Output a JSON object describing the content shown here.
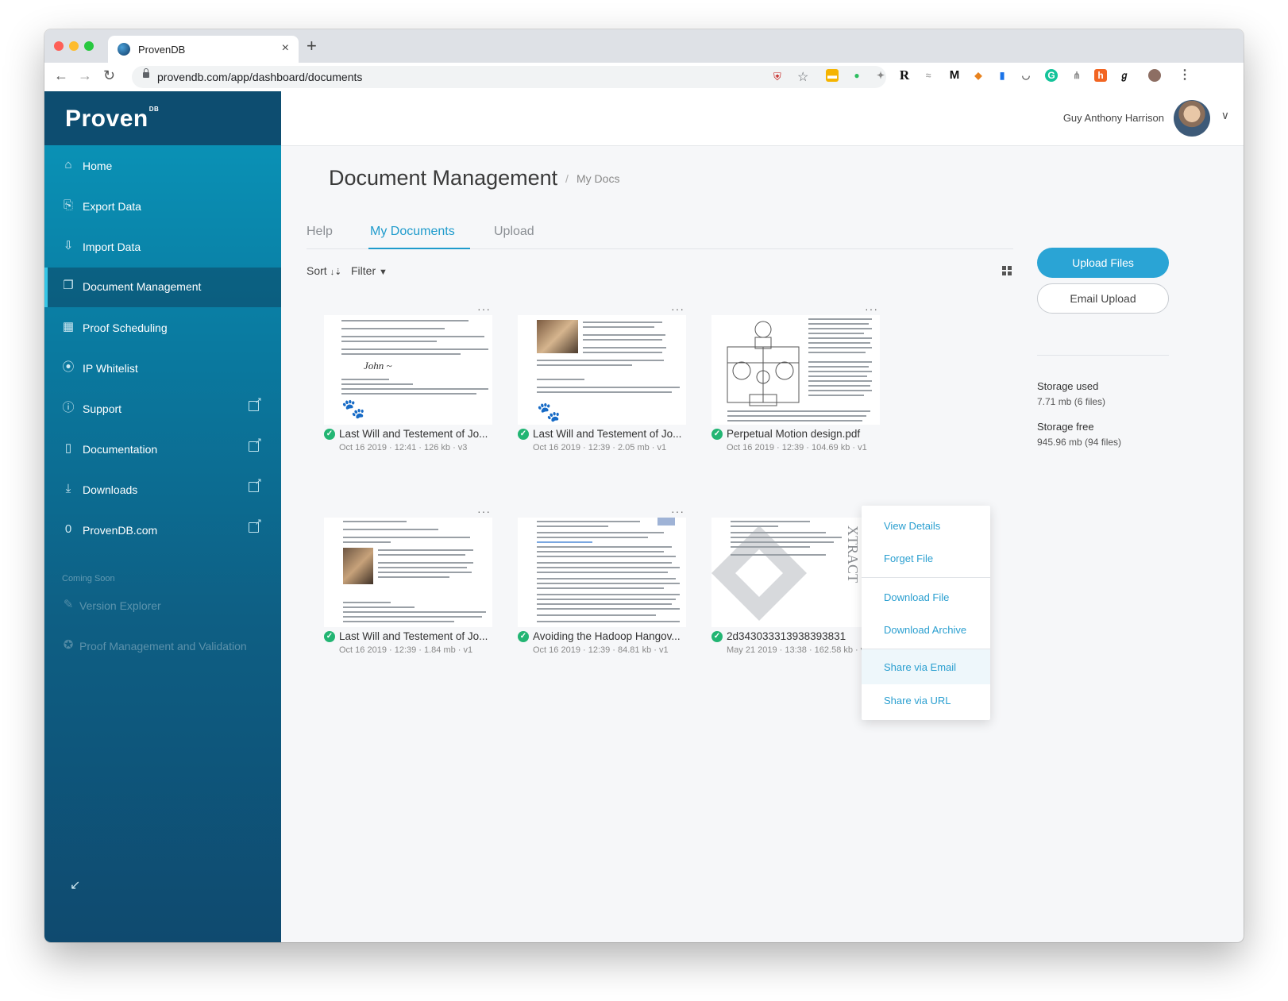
{
  "browser": {
    "tab_title": "ProvenDB",
    "url": "provendb.com/app/dashboard/documents"
  },
  "sidebar": {
    "logo": "Proven",
    "logo_sup": "DB",
    "items": [
      {
        "label": "Home",
        "icon": "home-icon"
      },
      {
        "label": "Export Data",
        "icon": "export-icon"
      },
      {
        "label": "Import Data",
        "icon": "import-icon"
      },
      {
        "label": "Document Management",
        "icon": "documents-icon"
      },
      {
        "label": "Proof Scheduling",
        "icon": "calendar-icon"
      },
      {
        "label": "IP Whitelist",
        "icon": "ip-icon"
      },
      {
        "label": "Support",
        "icon": "help-icon"
      },
      {
        "label": "Documentation",
        "icon": "file-icon"
      },
      {
        "label": "Downloads",
        "icon": "download-icon"
      },
      {
        "label": "ProvenDB.com",
        "icon": "link-icon"
      }
    ],
    "coming_soon": "Coming Soon",
    "soon_items": [
      {
        "label": "Version Explorer",
        "icon": "pen-icon"
      },
      {
        "label": "Proof Management and Validation",
        "icon": "badge-icon"
      }
    ]
  },
  "header": {
    "user_name": "Guy Anthony Harrison"
  },
  "page": {
    "title": "Document Management",
    "breadcrumb_sep": "/",
    "breadcrumb": "My Docs",
    "tabs": [
      {
        "label": "Help"
      },
      {
        "label": "My Documents"
      },
      {
        "label": "Upload"
      }
    ],
    "sort_label": "Sort",
    "filter_label": "Filter"
  },
  "documents": [
    {
      "name": "Last Will and Testement of Jo...",
      "meta": "Oct 16 2019 · 12:41 · 126 kb · v3"
    },
    {
      "name": "Last Will and Testement of Jo...",
      "meta": "Oct 16 2019 · 12:39 · 2.05 mb · v1"
    },
    {
      "name": "Perpetual Motion design.pdf",
      "meta": "Oct 16 2019 · 12:39 · 104.69 kb · v1"
    },
    {
      "name": "Last Will and Testement of Jo...",
      "meta": "Oct 16 2019 · 12:39 · 1.84 mb · v1"
    },
    {
      "name": "Avoiding the Hadoop Hangov...",
      "meta": "Oct 16 2019 · 12:39 · 84.81 kb · v1"
    },
    {
      "name": "2d343033313938393831",
      "meta": "May 21 2019 · 13:38 · 162.58 kb · v1"
    }
  ],
  "actions": {
    "upload_files": "Upload Files",
    "email_upload": "Email Upload"
  },
  "storage": {
    "used_label": "Storage used",
    "used_value": "7.71 mb (6 files)",
    "free_label": "Storage free",
    "free_value": "945.96 mb (94 files)"
  },
  "context_menu": {
    "items": [
      "View Details",
      "Forget File",
      "Download File",
      "Download Archive",
      "Share via Email",
      "Share via URL"
    ]
  },
  "colors": {
    "accent": "#2aa4d5",
    "success": "#22b573",
    "sidebar_top": "#0a97bb",
    "sidebar_bottom": "#0f4a6f"
  }
}
